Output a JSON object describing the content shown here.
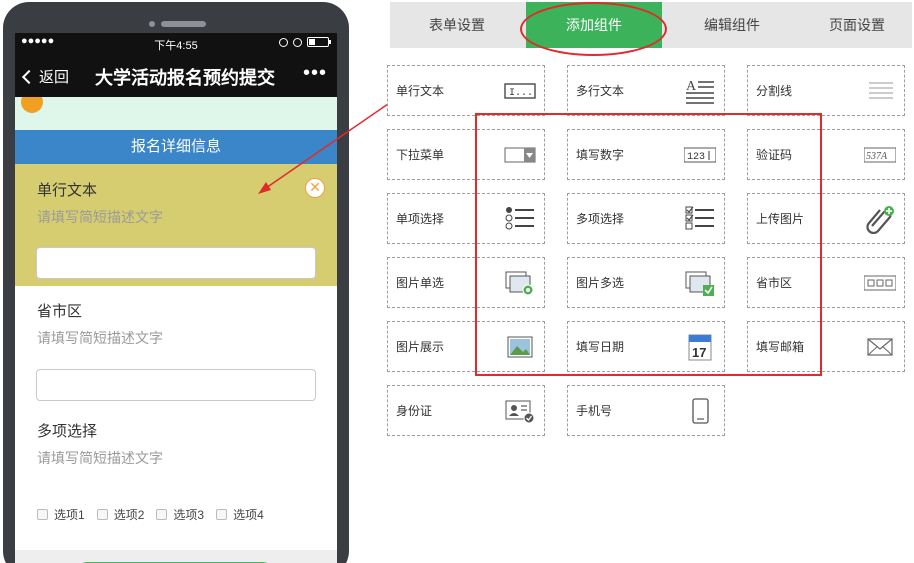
{
  "phone": {
    "status_bar": {
      "signal": "●●●●●",
      "time": "下午4:55"
    },
    "nav": {
      "back_label": "返回",
      "title": "大学活动报名预约提交",
      "more": "•••"
    },
    "section_header": "报名详细信息",
    "fields": [
      {
        "title": "单行文本",
        "description": "请填写简短描述文字",
        "selected": true
      },
      {
        "title": "省市区",
        "description": "请填写简短描述文字"
      },
      {
        "title": "多项选择",
        "description": "请填写简短描述文字",
        "options": [
          "选项1",
          "选项2",
          "选项3",
          "选项4"
        ]
      }
    ],
    "delete_glyph": "✕"
  },
  "editor": {
    "tabs": [
      {
        "label": "表单设置"
      },
      {
        "label": "添加组件",
        "active": true
      },
      {
        "label": "编辑组件"
      },
      {
        "label": "页面设置"
      }
    ],
    "components": [
      {
        "label": "单行文本",
        "icon": "single-line-text-icon"
      },
      {
        "label": "多行文本",
        "icon": "multi-line-text-icon"
      },
      {
        "label": "分割线",
        "icon": "divider-icon"
      },
      {
        "label": "下拉菜单",
        "icon": "dropdown-icon"
      },
      {
        "label": "填写数字",
        "icon": "number-input-icon"
      },
      {
        "label": "验证码",
        "icon": "captcha-icon"
      },
      {
        "label": "单项选择",
        "icon": "radio-list-icon"
      },
      {
        "label": "多项选择",
        "icon": "checkbox-list-icon"
      },
      {
        "label": "上传图片",
        "icon": "paperclip-icon"
      },
      {
        "label": "图片单选",
        "icon": "image-radio-icon"
      },
      {
        "label": "图片多选",
        "icon": "image-checkbox-icon"
      },
      {
        "label": "省市区",
        "icon": "region-selector-icon"
      },
      {
        "label": "图片展示",
        "icon": "image-display-icon"
      },
      {
        "label": "填写日期",
        "icon": "calendar-icon"
      },
      {
        "label": "填写邮箱",
        "icon": "envelope-icon"
      },
      {
        "label": "身份证",
        "icon": "id-card-icon"
      },
      {
        "label": "手机号",
        "icon": "mobile-phone-icon"
      }
    ],
    "icon_text": {
      "single_line": "I...",
      "number": "123",
      "captcha": "537A",
      "calendar_day": "17"
    }
  },
  "colors": {
    "accent_green": "#3cb35a",
    "annotation_red": "#e02b2b",
    "selected_field": "#d6cd70",
    "section_blue": "#3a86c8"
  }
}
